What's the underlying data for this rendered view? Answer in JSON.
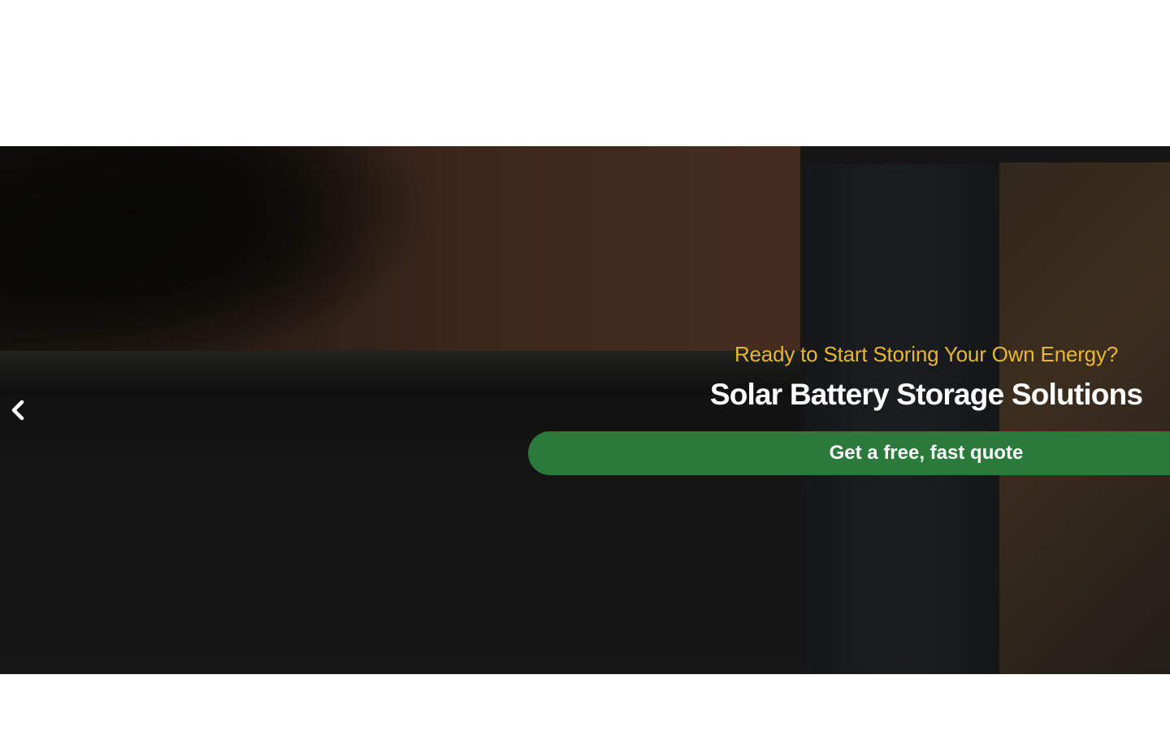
{
  "hero": {
    "eyebrow": "Ready to Start Storing Your Own Energy?",
    "headline": "Solar Battery Storage Solutions",
    "cta_label": "Get a free, fast quote",
    "prev_icon": "chevron-left-icon"
  },
  "colors": {
    "eyebrow": "#e9b82a",
    "headline": "#ffffff",
    "cta_background": "#2a7a3c",
    "cta_text": "#ffffff"
  }
}
